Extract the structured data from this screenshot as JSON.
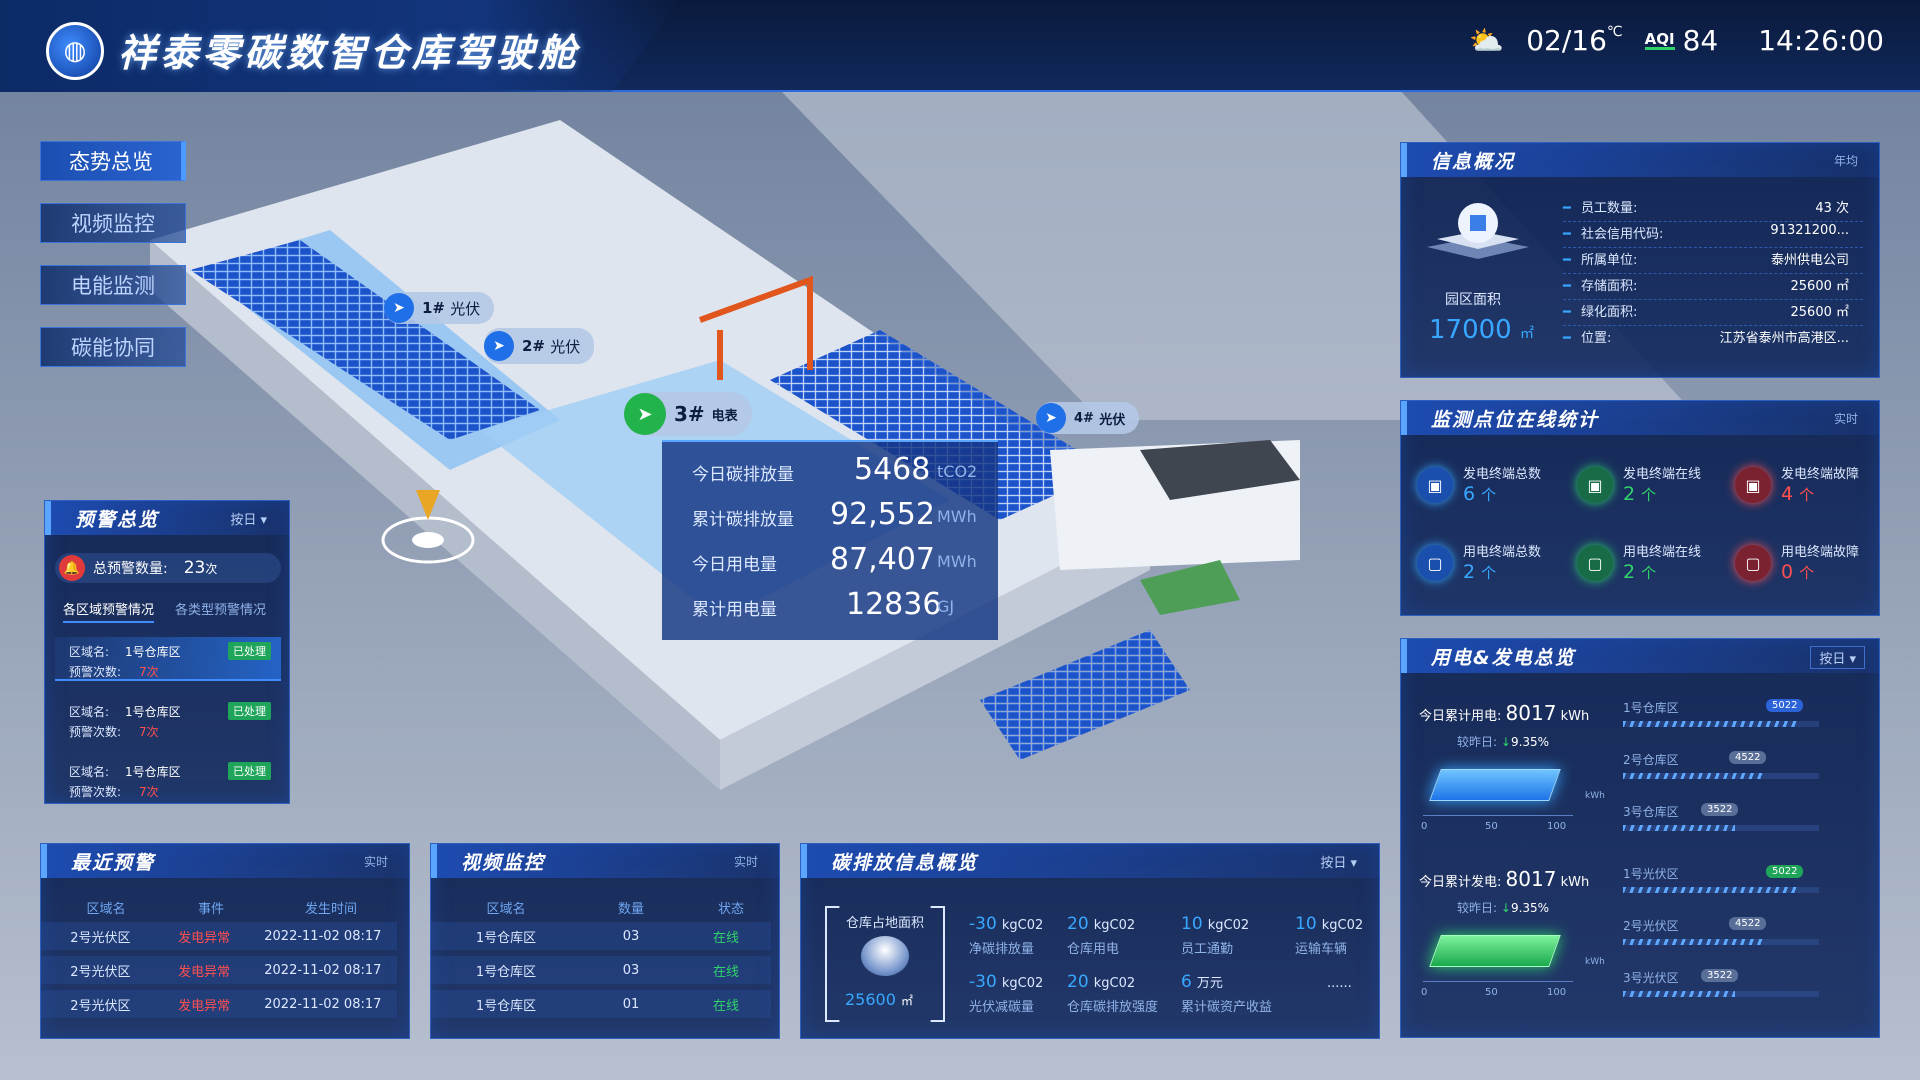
{
  "header": {
    "title": "祥泰零碳数智仓库驾驶舱",
    "date": "02/16",
    "temp_unit": "℃",
    "aqi_label": "AQI",
    "aqi_value": "84",
    "time": "14:26:00"
  },
  "nav": [
    "态势总览",
    "视频监控",
    "电能监测",
    "碳能协同"
  ],
  "map": {
    "pins": [
      {
        "id": "1#",
        "label": "光伏"
      },
      {
        "id": "2#",
        "label": "光伏"
      },
      {
        "id": "3#",
        "label": "电表"
      },
      {
        "id": "4#",
        "label": "光伏"
      }
    ],
    "stats": [
      {
        "label": "今日碳排放量",
        "value": "5468",
        "unit": "tCO2"
      },
      {
        "label": "累计碳排放量",
        "value": "92,552",
        "unit": "MWh"
      },
      {
        "label": "今日用电量",
        "value": "87,407",
        "unit": "MWh"
      },
      {
        "label": "累计用电量",
        "value": "12836",
        "unit": "GJ"
      }
    ]
  },
  "warning": {
    "title": "预警总览",
    "filter": "按日",
    "total_label": "总预警数量:",
    "total_value": "23",
    "total_unit": "次",
    "tabs": [
      "各区域预警情况",
      "各类型预警情况"
    ],
    "items": [
      {
        "area_label": "区域名:",
        "area": "1号仓库区",
        "status": "已处理",
        "count_label": "预警次数:",
        "count": "7次"
      },
      {
        "area_label": "区域名:",
        "area": "1号仓库区",
        "status": "已处理",
        "count_label": "预警次数:",
        "count": "7次"
      },
      {
        "area_label": "区域名:",
        "area": "1号仓库区",
        "status": "已处理",
        "count_label": "预警次数:",
        "count": "7次"
      }
    ]
  },
  "recent": {
    "title": "最近预警",
    "tag": "实时",
    "headers": [
      "区域名",
      "事件",
      "发生时间"
    ],
    "rows": [
      [
        "2号光伏区",
        "发电异常",
        "2022-11-02 08:17"
      ],
      [
        "2号光伏区",
        "发电异常",
        "2022-11-02 08:17"
      ],
      [
        "2号光伏区",
        "发电异常",
        "2022-11-02 08:17"
      ]
    ]
  },
  "video": {
    "title": "视频监控",
    "tag": "实时",
    "headers": [
      "区域名",
      "数量",
      "状态"
    ],
    "rows": [
      [
        "1号仓库区",
        "03",
        "在线"
      ],
      [
        "1号仓库区",
        "03",
        "在线"
      ],
      [
        "1号仓库区",
        "01",
        "在线"
      ]
    ]
  },
  "carbon": {
    "title": "碳排放信息概览",
    "filter": "按日",
    "area_label": "仓库占地面积",
    "area_value": "25600",
    "area_unit": "㎡",
    "cells": [
      {
        "v": "-30",
        "u": "kgC02",
        "l": "净碳排放量"
      },
      {
        "v": "20",
        "u": "kgC02",
        "l": "仓库用电"
      },
      {
        "v": "10",
        "u": "kgC02",
        "l": "员工通勤"
      },
      {
        "v": "10",
        "u": "kgC02",
        "l": "运输车辆"
      },
      {
        "v": "-30",
        "u": "kgC02",
        "l": "光伏减碳量"
      },
      {
        "v": "20",
        "u": "kgC02",
        "l": "仓库碳排放强度"
      },
      {
        "v": "6",
        "u": "万元",
        "l": "累计碳资产收益"
      },
      {
        "v": "......",
        "u": "",
        "l": ""
      }
    ]
  },
  "info": {
    "title": "信息概况",
    "tag": "年均",
    "park_label": "园区面积",
    "park_value": "17000",
    "park_unit": "㎡",
    "rows": [
      {
        "k": "员工数量:",
        "v": "43 次"
      },
      {
        "k": "社会信用代码:",
        "v": "91321200..."
      },
      {
        "k": "所属单位:",
        "v": "泰州供电公司"
      },
      {
        "k": "存储面积:",
        "v": "25600 ㎡"
      },
      {
        "k": "绿化面积:",
        "v": "25600 ㎡"
      },
      {
        "k": "位置:",
        "v": "江苏省泰州市高港区..."
      }
    ]
  },
  "monitor": {
    "title": "监测点位在线统计",
    "tag": "实时",
    "items": [
      {
        "label": "发电终端总数",
        "value": "6",
        "unit": "个",
        "color": "#38a7ff"
      },
      {
        "label": "发电终端在线",
        "value": "2",
        "unit": "个",
        "color": "#2fd36a"
      },
      {
        "label": "发电终端故障",
        "value": "4",
        "unit": "个",
        "color": "#ff4f4f"
      },
      {
        "label": "用电终端总数",
        "value": "2",
        "unit": "个",
        "color": "#38a7ff"
      },
      {
        "label": "用电终端在线",
        "value": "2",
        "unit": "个",
        "color": "#2fd36a"
      },
      {
        "label": "用电终端故障",
        "value": "0",
        "unit": "个",
        "color": "#ff4f4f"
      }
    ]
  },
  "power": {
    "title": "用电&发电总览",
    "filter": "按日",
    "use": {
      "label": "今日累计用电:",
      "value": "8017",
      "unit": "kWh",
      "cmp_label": "较昨日:",
      "cmp": "9.35%",
      "axis": [
        "0",
        "50",
        "100"
      ],
      "axis_unit": "kWh",
      "zones": [
        {
          "name": "1号仓库区",
          "badge": "5022",
          "fill": 0.95
        },
        {
          "name": "2号仓库区",
          "badge": "4522",
          "fill": 0.75
        },
        {
          "name": "3号仓库区",
          "badge": "3522",
          "fill": 0.6
        }
      ]
    },
    "gen": {
      "label": "今日累计发电:",
      "value": "8017",
      "unit": "kWh",
      "cmp_label": "较昨日:",
      "cmp": "9.35%",
      "axis": [
        "0",
        "50",
        "100"
      ],
      "axis_unit": "kWh",
      "zones": [
        {
          "name": "1号光伏区",
          "badge": "5022",
          "fill": 0.95
        },
        {
          "name": "2号光伏区",
          "badge": "4522",
          "fill": 0.75
        },
        {
          "name": "3号光伏区",
          "badge": "3522",
          "fill": 0.6
        }
      ]
    }
  }
}
